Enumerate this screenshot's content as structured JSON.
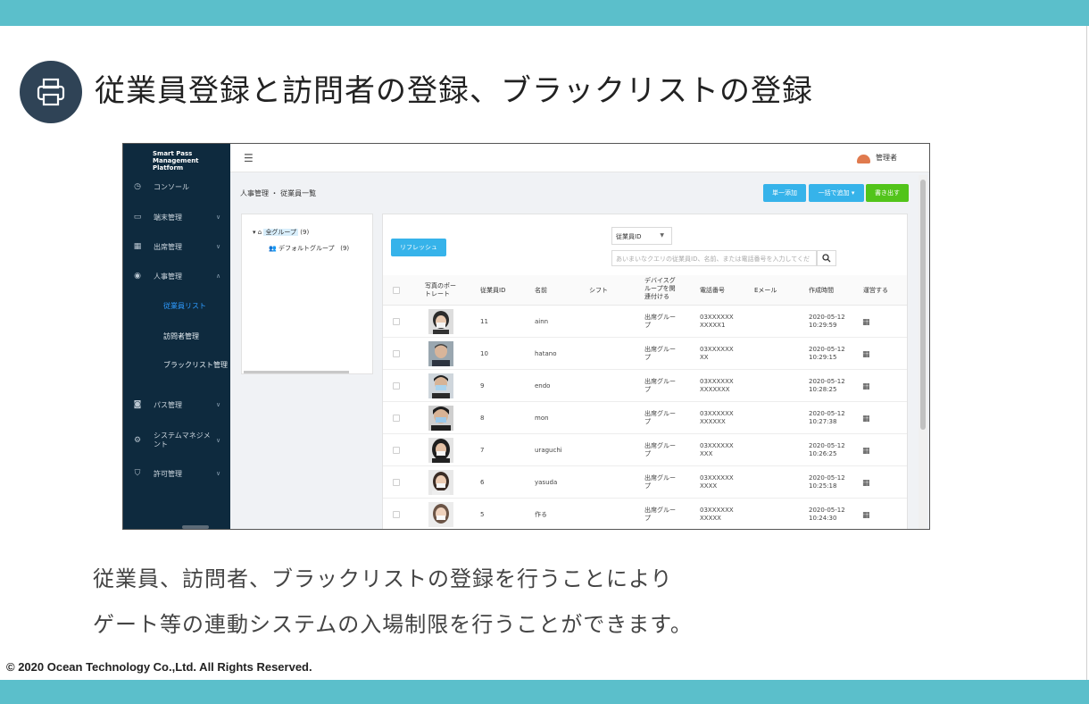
{
  "slide": {
    "title": "従業員登録と訪問者の登録、ブラックリストの登録",
    "title_icon": "printer-icon",
    "description_line1": "従業員、訪問者、ブラックリストの登録を行うことにより",
    "description_line2": "ゲート等の連動システムの入場制限を行うことができます。",
    "copyright": "© 2020 Ocean Technology Co.,Ltd. All Rights Reserved.",
    "accent_color": "#5bbfcb",
    "icon_bg_color": "#2f4356"
  },
  "app": {
    "brand_line1": "Smart Pass",
    "brand_line2": "Management Platform",
    "user": "管理者",
    "breadcrumb": "人事管理 ・ 従業員一覧",
    "sidebar": {
      "items": [
        {
          "label": "コンソール",
          "icon": "console-icon"
        },
        {
          "label": "端末管理",
          "icon": "device-icon"
        },
        {
          "label": "出席管理",
          "icon": "calendar-icon"
        },
        {
          "label": "人事管理",
          "icon": "person-icon"
        },
        {
          "label": "パス管理",
          "icon": "pass-icon"
        },
        {
          "label": "システムマネジメント",
          "icon": "gear-icon"
        },
        {
          "label": "許可管理",
          "icon": "shield-icon"
        }
      ],
      "subitems": [
        "従業員リスト",
        "訪問者管理",
        "ブラックリスト管理"
      ]
    },
    "buttons": {
      "single_add": "単一添加",
      "bulk_add": "一括で追加",
      "export": "書き出す",
      "refresh": "リフレッシュ"
    },
    "tree": {
      "root": "全グループ",
      "root_count": "(9)",
      "child": "デフォルトグループ",
      "child_count": "(9)"
    },
    "filter": {
      "select_value": "従業員ID",
      "search_placeholder": "あいまいなクエリの従業員ID、名前、または電話番号を入力してくだ"
    },
    "table": {
      "headers": [
        "写真のポートレート",
        "従業員ID",
        "名前",
        "シフト",
        "デバイスグループを関連付ける",
        "電話番号",
        "Eメール",
        "作成時間",
        "運営する"
      ],
      "rows": [
        {
          "id": "11",
          "name": "ainn",
          "group": "出席グループ",
          "phone": "03XXXXXXXXXXX1",
          "created": "2020-05-12 10:29:59"
        },
        {
          "id": "10",
          "name": "hatano",
          "group": "出席グループ",
          "phone": "03XXXXXXXX",
          "created": "2020-05-12 10:29:15"
        },
        {
          "id": "9",
          "name": "endo",
          "group": "出席グループ",
          "phone": "03XXXXXXXXXXXXX",
          "created": "2020-05-12 10:28:25"
        },
        {
          "id": "8",
          "name": "mon",
          "group": "出席グループ",
          "phone": "03XXXXXXXXXXXX",
          "created": "2020-05-12 10:27:38"
        },
        {
          "id": "7",
          "name": "uraguchi",
          "group": "出席グループ",
          "phone": "03XXXXXXXXX",
          "created": "2020-05-12 10:26:25"
        },
        {
          "id": "6",
          "name": "yasuda",
          "group": "出席グループ",
          "phone": "03XXXXXXXXXX",
          "created": "2020-05-12 10:25:18"
        },
        {
          "id": "5",
          "name": "作る",
          "group": "出席グループ",
          "phone": "03XXXXXXXXXXX",
          "created": "2020-05-12 10:24:30"
        }
      ]
    }
  }
}
